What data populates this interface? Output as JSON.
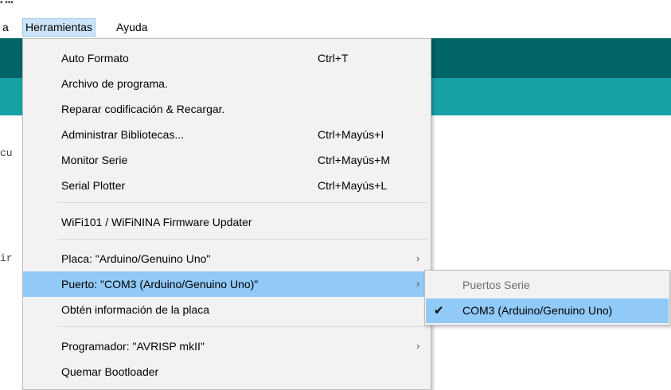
{
  "window_fragment": "• •••",
  "menubar": {
    "items": [
      "a",
      "Herramientas",
      "Ayuda"
    ]
  },
  "editor": {
    "code_fragments": [
      "cu",
      "ir"
    ]
  },
  "tools_menu": {
    "items": [
      {
        "label": "Auto Formato",
        "shortcut": "Ctrl+T"
      },
      {
        "label": "Archivo de programa.",
        "shortcut": ""
      },
      {
        "label": "Reparar codificación & Recargar.",
        "shortcut": ""
      },
      {
        "label": "Administrar Bibliotecas...",
        "shortcut": "Ctrl+Mayús+I"
      },
      {
        "label": "Monitor Serie",
        "shortcut": "Ctrl+Mayús+M"
      },
      {
        "label": "Serial Plotter",
        "shortcut": "Ctrl+Mayús+L"
      },
      {
        "label": "WiFi101 / WiFiNINA Firmware Updater",
        "shortcut": ""
      },
      {
        "label": "Placa: \"Arduino/Genuino Uno\"",
        "shortcut": ""
      },
      {
        "label": "Puerto: \"COM3 (Arduino/Genuino Uno)\"",
        "shortcut": ""
      },
      {
        "label": "Obtén información de la placa",
        "shortcut": ""
      },
      {
        "label": "Programador: \"AVRISP mkII\"",
        "shortcut": ""
      },
      {
        "label": "Quemar Bootloader",
        "shortcut": ""
      }
    ],
    "submenu_arrow": "›"
  },
  "port_submenu": {
    "header": "Puertos Serie",
    "item": "COM3 (Arduino/Genuino Uno)",
    "check_glyph": "✔"
  }
}
